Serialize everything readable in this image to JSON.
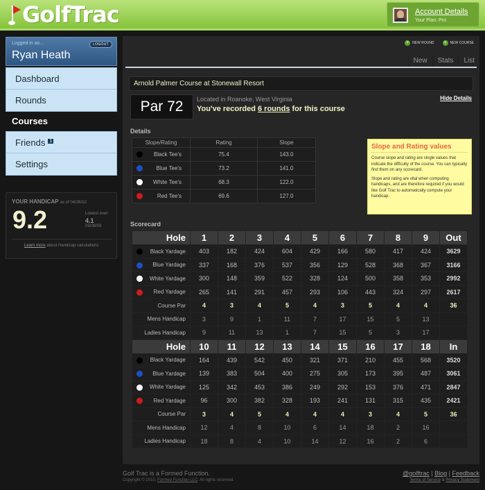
{
  "app": {
    "logo": "GolfTrac"
  },
  "account": {
    "link": "Account Details",
    "plan": "Your Plan: Pro"
  },
  "user": {
    "logged_in_label": "Logged in as...",
    "logout_label": "LOGOUT",
    "name": "Ryan Heath"
  },
  "nav": {
    "dashboard": "Dashboard",
    "rounds": "Rounds",
    "courses": "Courses",
    "friends": "Friends",
    "friends_badge": "1",
    "settings": "Settings"
  },
  "handicap": {
    "label": "YOUR HANDICAP",
    "as_of": "as of 04/26/10",
    "value": "9.2",
    "lowest_label": "Lowest ever:",
    "lowest_value": "4.1",
    "lowest_date": "05/08/09",
    "learn_more": "Learn more",
    "learn_more_rest": " about Handicap calculations"
  },
  "actions": {
    "new_round": "NEW ROUND",
    "new_course": "NEW COURSE"
  },
  "tabs": [
    "New",
    "Stats",
    "List"
  ],
  "course": {
    "name": "Arnold Palmer Course at Stonewall Resort",
    "par": "Par 72",
    "location": "Located in Roanoke, West Virginia",
    "recorded_prefix": "You've recorded ",
    "recorded_link": "6 rounds",
    "recorded_suffix": " for this course",
    "hide_details": "Hide Details"
  },
  "details": {
    "heading": "Details",
    "columns": [
      "Slope/Rating",
      "Rating",
      "Slope"
    ],
    "rows": [
      {
        "tee": "Black Tee's",
        "color": "#000000",
        "rating": "75.4",
        "slope": "143.0"
      },
      {
        "tee": "Blue Tee's",
        "color": "#1d4fc4",
        "rating": "73.2",
        "slope": "141.0"
      },
      {
        "tee": "White Tee's",
        "color": "#ffffff",
        "rating": "68.3",
        "slope": "122.0"
      },
      {
        "tee": "Red Tee's",
        "color": "#d11a1a",
        "rating": "69.6",
        "slope": "127.0"
      }
    ]
  },
  "info": {
    "title": "Slope and Rating values",
    "p1": "Course slope and rating are single values that indicate the difficulty of the course. You can typically find them on any scorecard.",
    "p2": "Slope and rating are vital when computing handicaps, and are therefore required if you would like Golf Trac to automatically compute your handicap."
  },
  "scorecard": {
    "heading": "Scorecard",
    "front": {
      "hole_label": "Hole",
      "holes": [
        "1",
        "2",
        "3",
        "4",
        "5",
        "6",
        "7",
        "8",
        "9"
      ],
      "total_label": "Out",
      "rows": [
        {
          "label": "Black Yardage",
          "color": "#000000",
          "values": [
            "403",
            "182",
            "424",
            "604",
            "429",
            "166",
            "580",
            "417",
            "424"
          ],
          "total": "3629",
          "kind": "yard"
        },
        {
          "label": "Blue Yardage",
          "color": "#1d4fc4",
          "values": [
            "337",
            "168",
            "376",
            "537",
            "356",
            "129",
            "528",
            "368",
            "367"
          ],
          "total": "3166",
          "kind": "yard"
        },
        {
          "label": "White Yardage",
          "color": "#ffffff",
          "values": [
            "300",
            "148",
            "359",
            "522",
            "328",
            "124",
            "500",
            "358",
            "353"
          ],
          "total": "2992",
          "kind": "yard"
        },
        {
          "label": "Red Yardage",
          "color": "#d11a1a",
          "values": [
            "265",
            "141",
            "291",
            "457",
            "293",
            "106",
            "443",
            "324",
            "297"
          ],
          "total": "2617",
          "kind": "yard"
        },
        {
          "label": "Course Par",
          "values": [
            "4",
            "3",
            "4",
            "5",
            "4",
            "3",
            "5",
            "4",
            "4"
          ],
          "total": "36",
          "kind": "par"
        },
        {
          "label": "Mens Handicap",
          "values": [
            "3",
            "9",
            "1",
            "11",
            "7",
            "17",
            "15",
            "5",
            "13"
          ],
          "total": "",
          "kind": "hcp"
        },
        {
          "label": "Ladies Handicap",
          "values": [
            "9",
            "11",
            "13",
            "1",
            "7",
            "15",
            "5",
            "3",
            "17"
          ],
          "total": "",
          "kind": "hcp"
        }
      ]
    },
    "back": {
      "hole_label": "Hole",
      "holes": [
        "10",
        "11",
        "12",
        "13",
        "14",
        "15",
        "16",
        "17",
        "18"
      ],
      "total_label": "In",
      "rows": [
        {
          "label": "Black Yardage",
          "color": "#000000",
          "values": [
            "164",
            "439",
            "542",
            "450",
            "321",
            "371",
            "210",
            "455",
            "568"
          ],
          "total": "3520",
          "kind": "yard"
        },
        {
          "label": "Blue Yardage",
          "color": "#1d4fc4",
          "values": [
            "139",
            "383",
            "504",
            "400",
            "275",
            "305",
            "173",
            "395",
            "487"
          ],
          "total": "3061",
          "kind": "yard"
        },
        {
          "label": "White Yardage",
          "color": "#ffffff",
          "values": [
            "125",
            "342",
            "453",
            "386",
            "249",
            "292",
            "153",
            "376",
            "471"
          ],
          "total": "2847",
          "kind": "yard"
        },
        {
          "label": "Red Yardage",
          "color": "#d11a1a",
          "values": [
            "96",
            "300",
            "382",
            "328",
            "193",
            "241",
            "131",
            "315",
            "435"
          ],
          "total": "2421",
          "kind": "yard"
        },
        {
          "label": "Course Par",
          "values": [
            "3",
            "4",
            "5",
            "4",
            "4",
            "4",
            "3",
            "4",
            "5"
          ],
          "total": "36",
          "kind": "par"
        },
        {
          "label": "Mens Handicap",
          "values": [
            "12",
            "4",
            "8",
            "10",
            "6",
            "14",
            "18",
            "2",
            "16"
          ],
          "total": "",
          "kind": "hcp"
        },
        {
          "label": "Ladies Handicap",
          "values": [
            "18",
            "8",
            "4",
            "10",
            "14",
            "12",
            "16",
            "2",
            "6"
          ],
          "total": "",
          "kind": "hcp"
        }
      ]
    }
  },
  "footer": {
    "tagline": "Golf Trac is a Formed Function.",
    "copyright_prefix": "Copyright © 2010, ",
    "copyright_link": "Formed Function LLC",
    "copyright_suffix": ". All rights reserved.",
    "twitter": "@golftrac",
    "blog": "Blog",
    "feedback": "Feedback",
    "tos": "Terms of Service",
    "privacy": "Privacy Statement"
  }
}
